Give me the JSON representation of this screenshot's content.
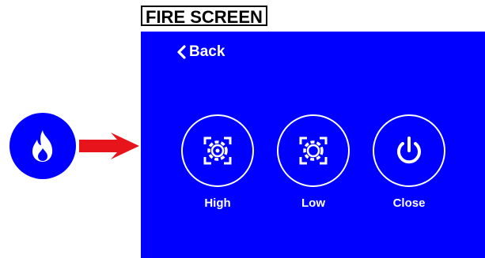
{
  "title": "FIRE SCREEN",
  "back_label": "Back",
  "buttons": [
    {
      "label": "High",
      "icon": "high-burner-icon"
    },
    {
      "label": "Low",
      "icon": "low-burner-icon"
    },
    {
      "label": "Close",
      "icon": "power-icon"
    }
  ],
  "fire_icon": "flame-icon",
  "colors": {
    "screen": "#0000ff",
    "arrow": "#e8141c",
    "foreground": "#ffffff"
  }
}
